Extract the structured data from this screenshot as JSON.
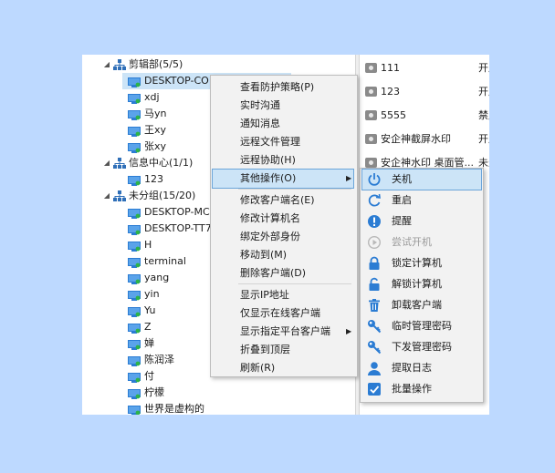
{
  "tree": [
    {
      "type": "group",
      "label": "剪辑部(5/5)"
    },
    {
      "type": "client",
      "label": "DESKTOP-CO",
      "selected": true
    },
    {
      "type": "client",
      "label": "xdj"
    },
    {
      "type": "client",
      "label": "马yn"
    },
    {
      "type": "client",
      "label": "王xy"
    },
    {
      "type": "client",
      "label": "张xy"
    },
    {
      "type": "group",
      "label": "信息中心(1/1)"
    },
    {
      "type": "client",
      "label": "123"
    },
    {
      "type": "group",
      "label": "未分组(15/20)"
    },
    {
      "type": "client",
      "label": "DESKTOP-MC"
    },
    {
      "type": "client",
      "label": "DESKTOP-TT7"
    },
    {
      "type": "client",
      "label": "H"
    },
    {
      "type": "client",
      "label": "terminal"
    },
    {
      "type": "client",
      "label": "yang"
    },
    {
      "type": "client",
      "label": "yin"
    },
    {
      "type": "client",
      "label": "Yu"
    },
    {
      "type": "client",
      "label": "Z"
    },
    {
      "type": "client",
      "label": "婵"
    },
    {
      "type": "client",
      "label": "陈润泽"
    },
    {
      "type": "client",
      "label": "付"
    },
    {
      "type": "client",
      "label": "柠檬"
    },
    {
      "type": "client",
      "label": "世界是虚构的"
    }
  ],
  "policies": [
    {
      "label": "111",
      "status": "开启"
    },
    {
      "label": "123",
      "status": "开启"
    },
    {
      "label": "5555",
      "status": "禁用"
    },
    {
      "label": "安企神截屏水印",
      "status": "开启"
    },
    {
      "label": "安企神水印 桌面管...",
      "status": "未生效"
    }
  ],
  "context_menu": {
    "groups": [
      [
        "查看防护策略(P)",
        "实时沟通",
        "通知消息",
        "远程文件管理",
        "远程协助(H)",
        "其他操作(O)"
      ],
      [
        "修改客户端名(E)",
        "修改计算机名",
        "绑定外部身份",
        "移动到(M)",
        "删除客户端(D)"
      ],
      [
        "显示IP地址",
        "仅显示在线客户端",
        "显示指定平台客户端",
        "折叠到顶层",
        "刷新(R)"
      ]
    ]
  },
  "submenu": [
    {
      "label": "关机",
      "icon": "power-icon",
      "color": "#2b7cd3",
      "disabled": false
    },
    {
      "label": "重启",
      "icon": "restart-icon",
      "color": "#2b7cd3",
      "disabled": false
    },
    {
      "label": "提醒",
      "icon": "alert-icon",
      "color": "#2b7cd3",
      "disabled": false
    },
    {
      "label": "尝试开机",
      "icon": "power-on-icon",
      "color": "#b8b8b8",
      "disabled": true
    },
    {
      "label": "锁定计算机",
      "icon": "lock-icon",
      "color": "#2b7cd3",
      "disabled": false
    },
    {
      "label": "解锁计算机",
      "icon": "unlock-icon",
      "color": "#2b7cd3",
      "disabled": false
    },
    {
      "label": "卸载客户端",
      "icon": "trash-icon",
      "color": "#2b7cd3",
      "disabled": false
    },
    {
      "label": "临时管理密码",
      "icon": "key-icon",
      "color": "#2b7cd3",
      "disabled": false
    },
    {
      "label": "下发管理密码",
      "icon": "key-icon",
      "color": "#2b7cd3",
      "disabled": false
    },
    {
      "label": "提取日志",
      "icon": "user-icon",
      "color": "#2b7cd3",
      "disabled": false
    },
    {
      "label": "批量操作",
      "icon": "checkbox-icon",
      "color": "#2b7cd3",
      "disabled": false
    }
  ]
}
